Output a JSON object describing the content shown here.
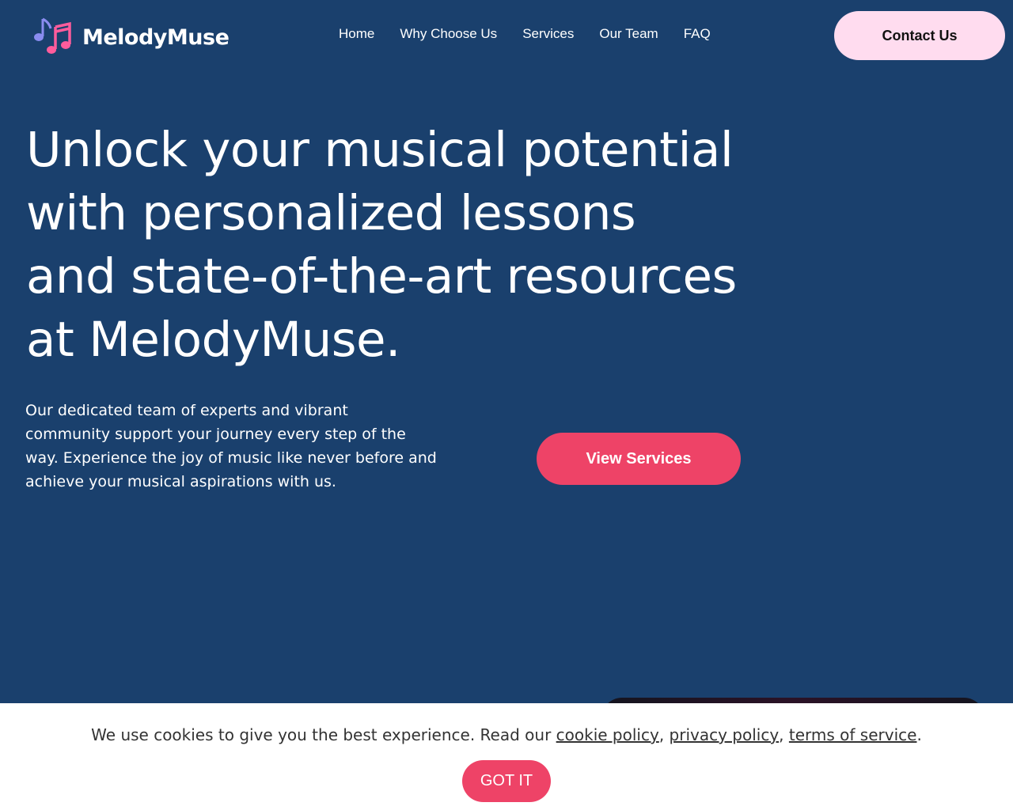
{
  "header": {
    "logo_text": "MelodyMuse",
    "logo_icon": "music-notes-icon",
    "nav": [
      "Home",
      "Why Choose Us",
      "Services",
      "Our Team",
      "FAQ"
    ],
    "contact_label": "Contact Us"
  },
  "hero": {
    "title": "Unlock your musical potential with personalized lessons and state-of-the-art resources at MelodyMuse.",
    "description": "Our dedicated team of experts and vibrant community support your journey every step of the way. Experience the joy of music like never before and achieve your musical aspirations with us.",
    "cta_label": "View Services"
  },
  "cookie": {
    "text_before": "We use cookies to give you the best experience. Read our ",
    "link_cookie": "cookie policy",
    "sep1": ", ",
    "link_privacy": "privacy policy",
    "sep2": ", ",
    "link_terms": "terms of service",
    "text_after": ".",
    "button_label": "GOT IT"
  },
  "colors": {
    "background": "#1a406d",
    "accent": "#ee4367",
    "contact_bg": "#ffdcef"
  }
}
